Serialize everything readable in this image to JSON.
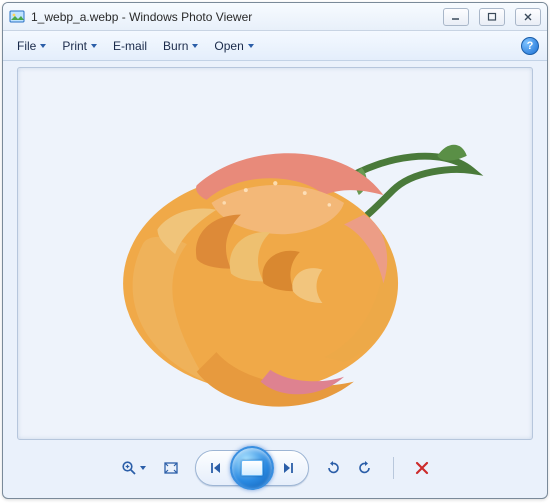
{
  "window": {
    "title": "1_webp_a.webp - Windows Photo Viewer"
  },
  "menubar": {
    "file": "File",
    "print": "Print",
    "email": "E-mail",
    "burn": "Burn",
    "open": "Open"
  },
  "icons": {
    "app": "photo-viewer-app-icon",
    "minimize": "minimize-icon",
    "maximize": "maximize-icon",
    "close": "close-icon",
    "help": "help-icon",
    "zoom": "magnifier-icon",
    "fit": "fit-window-icon",
    "prev": "previous-icon",
    "play": "slideshow-icon",
    "next": "next-icon",
    "rotate_ccw": "rotate-ccw-icon",
    "rotate_cw": "rotate-cw-icon",
    "delete": "delete-icon"
  },
  "image": {
    "description": "orange-pink rose flower with green stem"
  },
  "help_label": "?"
}
